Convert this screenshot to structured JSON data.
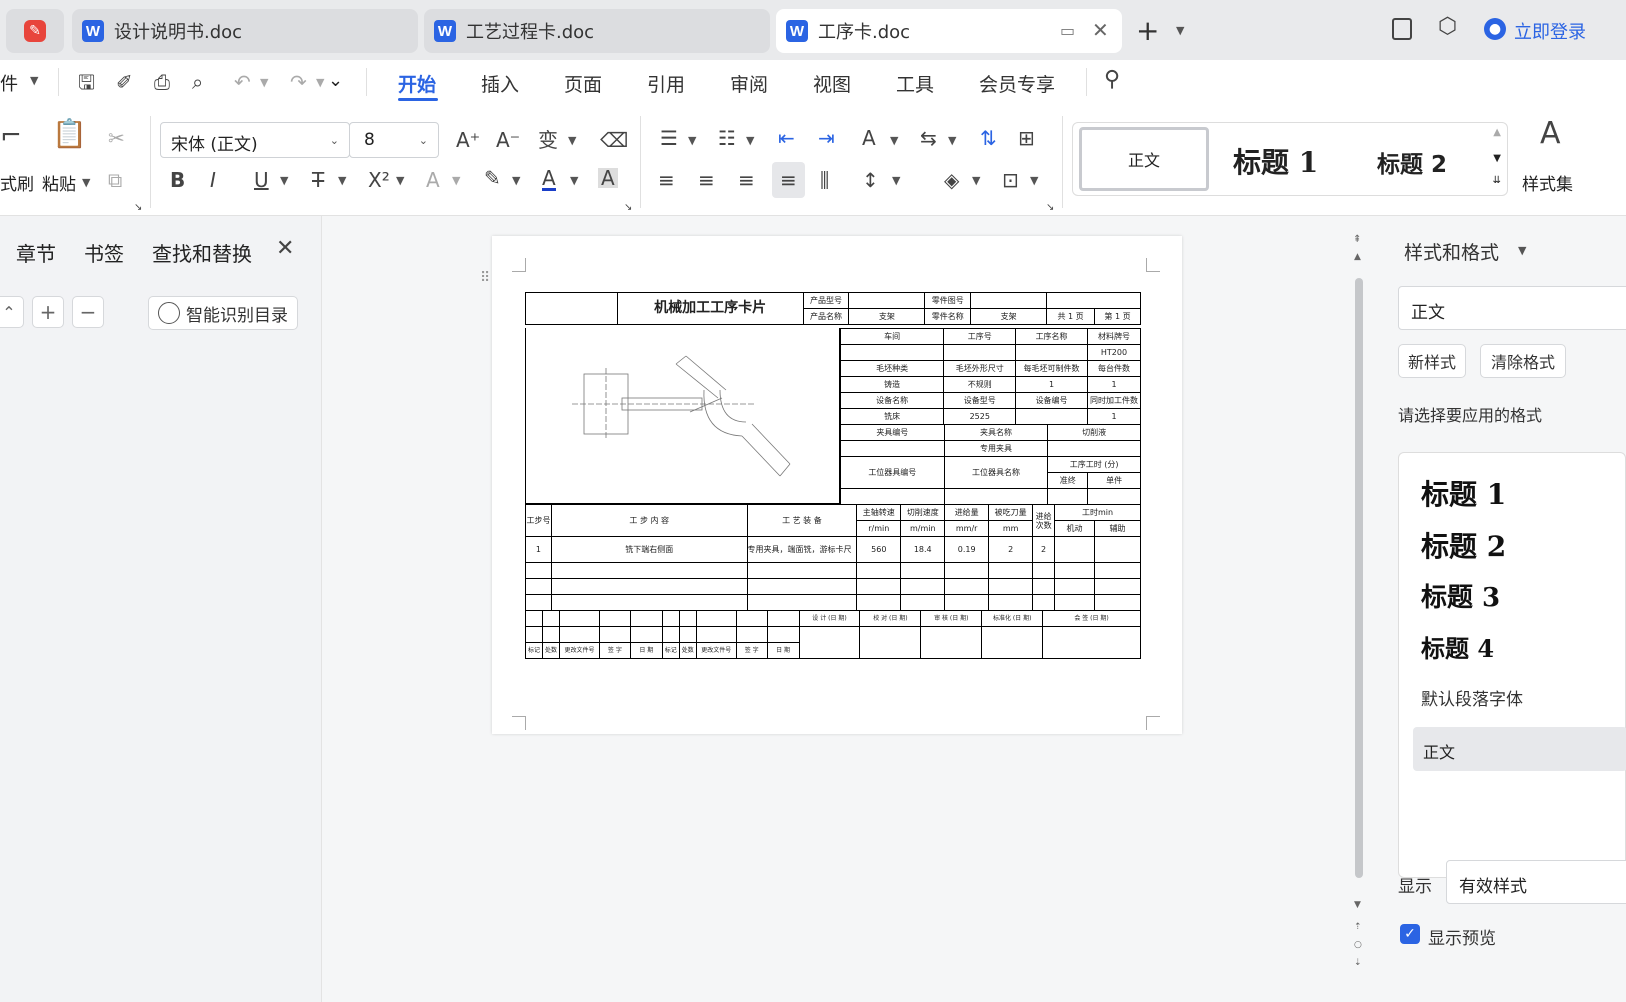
{
  "tabs": [
    {
      "label": "设计说明书.doc"
    },
    {
      "label": "工艺过程卡.doc"
    },
    {
      "label": "工序卡.doc"
    }
  ],
  "login_label": "立即登录",
  "file_menu_label": "件",
  "menu": [
    {
      "label": "开始",
      "active": true
    },
    {
      "label": "插入"
    },
    {
      "label": "页面"
    },
    {
      "label": "引用"
    },
    {
      "label": "审阅"
    },
    {
      "label": "视图"
    },
    {
      "label": "工具"
    },
    {
      "label": "会员专享"
    }
  ],
  "ribbon": {
    "format_painter_label": "式刷",
    "paste_label": "粘贴",
    "font_name": "宋体 (正文)",
    "font_size": "8",
    "style_gallery": [
      "正文",
      "标题 1",
      "标题 2"
    ],
    "style_set_label": "样式集"
  },
  "nav": {
    "tabs": [
      "章节",
      "书签",
      "查找和替换"
    ],
    "smart_toc_label": "智能识别目录"
  },
  "card": {
    "title": "机械加工工序卡片",
    "product_model_label": "产品型号",
    "part_drawing_label": "零件图号",
    "product_name_label": "产品名称",
    "product_name": "支架",
    "part_name_label": "零件名称",
    "part_name": "支架",
    "total_label": "共",
    "page_label": "页",
    "sheet_label": "第",
    "total_pages": "1",
    "page_no": "1",
    "workshop_label": "车间",
    "op_no_label": "工序号",
    "op_name_label": "工序名称",
    "material_label": "材料牌号",
    "material": "HT200",
    "blank_type_label": "毛坯种类",
    "blank_size_label": "毛坯外形尺寸",
    "per_blank_label": "每毛坯可制件数",
    "per_unit_label": "每台件数",
    "blank_type": "铸造",
    "blank_size": "不规则",
    "per_blank": "1",
    "per_unit": "1",
    "equip_name_label": "设备名称",
    "equip_model_label": "设备型号",
    "equip_no_label": "设备编号",
    "simul_label": "同时加工件数",
    "equip_name": "铣床",
    "equip_model": "2525",
    "simul": "1",
    "fixture_no_label": "夹具编号",
    "fixture_name_label": "夹具名称",
    "coolant_label": "切削液",
    "fixture_name": "专用夹具",
    "station_tool_no_label": "工位器具编号",
    "station_tool_name_label": "工位器具名称",
    "op_time_label": "工序工时 (分)",
    "prep_label": "准终",
    "unit_label": "单件",
    "step_no_label": "工步号",
    "step_content_label": "工 步 内 容",
    "process_equip_label": "工 艺 装 备",
    "spindle_label": "主轴转速",
    "spindle_unit": "r/min",
    "speed_label": "切削速度",
    "speed_unit": "m/min",
    "feed_label": "进给量",
    "feed_unit": "mm/r",
    "depth_label": "被吃刀量",
    "depth_unit": "mm",
    "passes_label": "进给次数",
    "time_label": "工时min",
    "machine_label": "机动",
    "aux_label": "辅助",
    "step1_no": "1",
    "step1_content": "铣下端右侧面",
    "step1_equip": "专用夹具，端面铣，游标卡尺",
    "step1_spindle": "560",
    "step1_speed": "18.4",
    "step1_feed": "0.19",
    "step1_depth": "2",
    "step1_passes": "2",
    "design_label": "设 计 (日 期)",
    "check_label": "校 对 (日 期)",
    "review_label": "审 核 (日 期)",
    "standard_label": "标准化 (日 期)",
    "sign_label": "会 签 (日 期)",
    "mark_label": "标记",
    "count_label": "处数",
    "change_doc_label": "更改文件号",
    "signature_label": "签 字",
    "date_label": "日 期"
  },
  "panel": {
    "title": "样式和格式",
    "current_style": "正文",
    "new_style_label": "新样式",
    "clear_format_label": "清除格式",
    "choose_label": "请选择要应用的格式",
    "styles": [
      "标题 1",
      "标题 2",
      "标题 3",
      "标题 4"
    ],
    "default_font_label": "默认段落字体",
    "normal_label": "正文",
    "show_label": "显示",
    "show_value": "有效样式",
    "preview_label": "显示预览"
  },
  "colors": {
    "accent": "#2b64e3",
    "tab_bg": "#dcdde0"
  }
}
